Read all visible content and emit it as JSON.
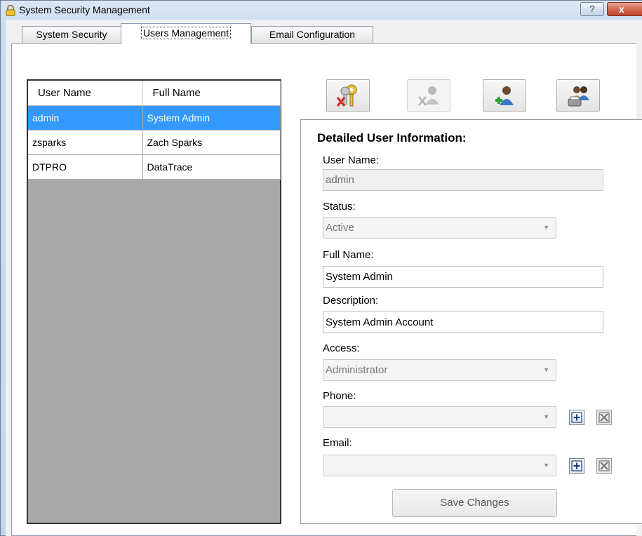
{
  "window": {
    "title": "System Security Management",
    "help_glyph": "?",
    "close_glyph": "x"
  },
  "tabs": [
    {
      "label": "System Security"
    },
    {
      "label": "Users Management"
    },
    {
      "label": "Email Configuration"
    }
  ],
  "users_grid": {
    "columns": [
      "User Name",
      "Full Name"
    ],
    "rows": [
      {
        "user_name": "admin",
        "full_name": "System Admin",
        "selected": true
      },
      {
        "user_name": "zsparks",
        "full_name": "Zach Sparks",
        "selected": false
      },
      {
        "user_name": "DTPRO",
        "full_name": "DataTrace",
        "selected": false
      }
    ]
  },
  "toolbar": {
    "buttons": [
      {
        "icon": "keys-reset-password-icon",
        "enabled": true
      },
      {
        "icon": "delete-user-icon",
        "enabled": false
      },
      {
        "icon": "add-user-icon",
        "enabled": true
      },
      {
        "icon": "print-users-icon",
        "enabled": true
      }
    ]
  },
  "details": {
    "title": "Detailed User Information:",
    "user_name_label": "User Name:",
    "user_name_value": "admin",
    "status_label": "Status:",
    "status_value": "Active",
    "full_name_label": "Full Name:",
    "full_name_value": "System Admin",
    "description_label": "Description:",
    "description_value": "System Admin Account",
    "access_label": "Access:",
    "access_value": "Administrator",
    "phone_label": "Phone:",
    "phone_value": "",
    "email_label": "Email:",
    "email_value": "",
    "save_label": "Save Changes"
  },
  "colors": {
    "selection": "#3399ff",
    "grid_background": "#a9a9a9",
    "close_button": "#c0432a"
  }
}
